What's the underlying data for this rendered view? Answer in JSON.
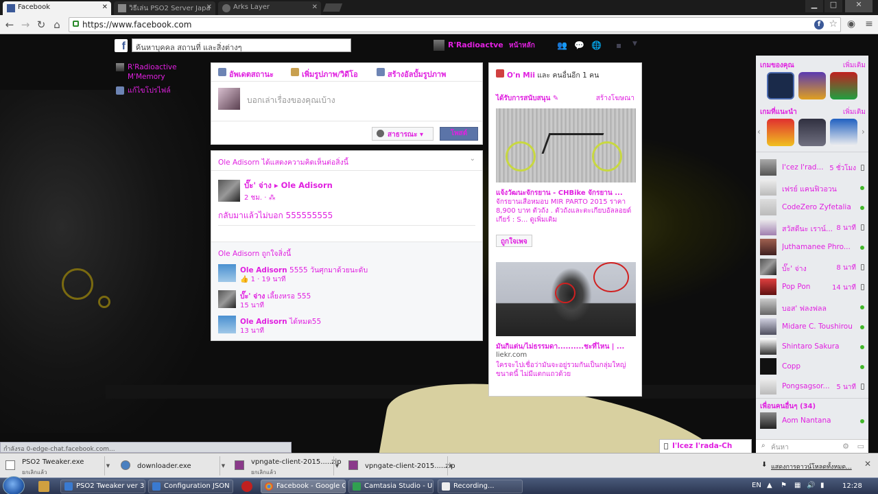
{
  "browser": {
    "tabs": [
      {
        "label": "Facebook",
        "active": true
      },
      {
        "label": "วิธีเล่น PSO2 Server Japa",
        "active": false
      },
      {
        "label": "Arks Layer",
        "active": false
      }
    ],
    "url": "https://www.facebook.com"
  },
  "fb_header": {
    "search_placeholder": "ค้นหาบุคคล สถานที่ และสิ่งต่างๆ",
    "user_name": "R'Radioactve",
    "home_label": "หน้าหลัก"
  },
  "left_nav": {
    "items": [
      {
        "label": "R'Radioactive M'Memory"
      },
      {
        "label": "แก้ไขโปรไฟล์"
      }
    ]
  },
  "composer": {
    "tabs": [
      "อัพเดตสถานะ",
      "เพิ่มรูปภาพ/วิดีโอ",
      "สร้างอัลบั้มรูปภาพ"
    ],
    "placeholder": "บอกเล่าเรื่องของคุณเบ้าง",
    "audience_label": "สาธารณะ",
    "post_label": "โพสต์"
  },
  "feed": {
    "header": "Ole Adisorn ได้แสดงความคิดเห็นต่อสิ่งนี้",
    "post": {
      "author": "บั๊ะ' จ่าง",
      "target": "Ole Adisorn",
      "meta": "2 ชม. · ⁂",
      "text": "กลับมาแล้วไม่บอก 555555555"
    },
    "likes_header": "Ole Adisorn ถูกใจสิ่งนี้",
    "comments": [
      {
        "name": "Ole Adisorn",
        "text": "5555 วันศุกมาด้วยนะดับ",
        "meta": "1 · 19 นาที",
        "likes": "1"
      },
      {
        "name": "บั๊ะ' จ่าง",
        "text": "เลี้ยงหรอ 555",
        "meta": "15 นาที"
      },
      {
        "name": "Ole Adisorn",
        "text": "ได้หมด55",
        "meta": "13 นาที"
      }
    ]
  },
  "ads": {
    "birthday": {
      "name": "O'n Mii",
      "rest": "และ คนอื่นอีก 1 คน"
    },
    "sponsored_label": "ได้รับการสนับสนุน",
    "create_ad_label": "สร้างโฆษณา",
    "ad1": {
      "title": "แจ้งวัฒนะจักรยาน - CHBike จักรยาน ...",
      "desc": "จักรยานเสือหมอบ MIR PARTO 2015 ราคา 8,900 บาท ตัวถัง . ตัวถังและตะเกียบอัลลอยด์ เกียร์ : S... ดูเพิ่มเติม",
      "like_button": "ถูกใจเพจ"
    },
    "ad2": {
      "title": "มันกิแต่น/ไม่ธรรมดา..........ชะที่ไหน | ...",
      "url": "liekr.com",
      "desc": "ใครจะไปเชื่อว่ามันจะอยู่รวมกันเป็นกลุ่มใหญ่ขนาดนี้ ไม่มีแตกแถวด้วย"
    }
  },
  "right_sidebar": {
    "your_games_label": "เกมของคุณ",
    "recommended_label": "เกมที่แนะนำ",
    "more_label": "เพิ่มเติม",
    "friends": [
      {
        "name": "I'cez I'rad...",
        "time": "5 ชั่วโมง",
        "status": "mobile"
      },
      {
        "name": "เฟรย์ แคนฟิวอวน",
        "time": "",
        "status": "online"
      },
      {
        "name": "CodeZero Zyfetalia",
        "time": "",
        "status": "online"
      },
      {
        "name": "สวัสดีนะ เราน์...",
        "time": "8 นาที",
        "status": "mobile"
      },
      {
        "name": "Juthamanee Phro...",
        "time": "",
        "status": "online"
      },
      {
        "name": "บั๊ะ' จ่าง",
        "time": "8 นาที",
        "status": "mobile"
      },
      {
        "name": "Pop Pon",
        "time": "14 นาที",
        "status": "mobile"
      },
      {
        "name": "บอส' ฟลงฟลล",
        "time": "",
        "status": "online"
      },
      {
        "name": "Midare C. Toushirou",
        "time": "",
        "status": "online"
      },
      {
        "name": "Shintaro Sakura",
        "time": "",
        "status": "online"
      },
      {
        "name": "Copp",
        "time": "",
        "status": "online"
      },
      {
        "name": "Pongsagsor...",
        "time": "5 นาที",
        "status": "mobile"
      }
    ],
    "more_friends_label": "เพื่อนคนอื่นๆ (34)",
    "more_friends": [
      {
        "name": "Aom Nantana",
        "status": "online"
      }
    ],
    "search_placeholder": "ค้นหา"
  },
  "chat_tab": {
    "name": "I'lcez I'rada-Ch"
  },
  "status_text": "กำลังรอ 0-edge-chat.facebook.com...",
  "downloads": {
    "items": [
      {
        "name": "PSO2 Tweaker.exe",
        "status": "ยกเลิกแล้ว"
      },
      {
        "name": "downloader.exe",
        "status": ""
      },
      {
        "name": "vpngate-client-2015.....zip",
        "status": "ยกเลิกแล้ว"
      },
      {
        "name": "vpngate-client-2015.....zip",
        "status": ""
      }
    ],
    "show_all": "แสดงการดาวน์โหลดทั้งหมด..."
  },
  "taskbar": {
    "items": [
      {
        "label": "PSO2 Tweaker ver 3....",
        "active": false
      },
      {
        "label": "Configuration JSON",
        "active": false
      },
      {
        "label": "Facebook - Google C...",
        "active": true
      },
      {
        "label": "Camtasia Studio - U...",
        "active": false
      },
      {
        "label": "Recording...",
        "active": false
      }
    ],
    "lang": "EN",
    "clock": "12:28"
  }
}
